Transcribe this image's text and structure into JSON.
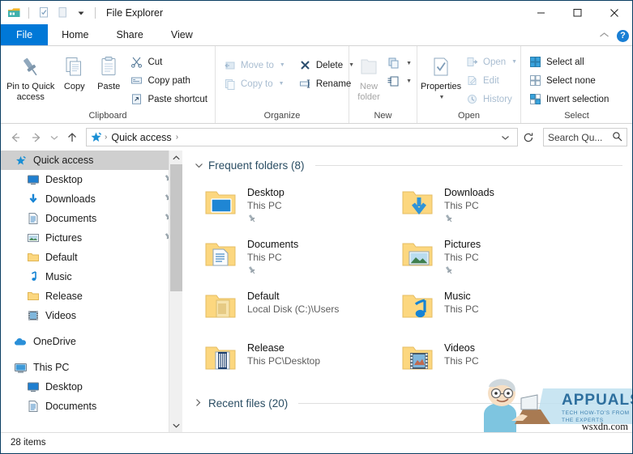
{
  "window": {
    "title": "File Explorer",
    "controls": {
      "minimize": "—",
      "maximize": "☐",
      "close": "✕"
    },
    "quick_access_toolbar": [
      "explorer-icon",
      "properties-checkbox-icon",
      "new-folder-icon",
      "customize-dropdown-icon"
    ]
  },
  "tabs": [
    {
      "label": "File",
      "kind": "file"
    },
    {
      "label": "Home",
      "kind": "active"
    },
    {
      "label": "Share",
      "kind": "normal"
    },
    {
      "label": "View",
      "kind": "normal"
    }
  ],
  "tabbar_right": {
    "collapse": "⌃",
    "help": "?"
  },
  "ribbon": {
    "groups": [
      {
        "label": "Clipboard",
        "big_buttons": [
          {
            "label": "Pin to Quick access",
            "icon": "pin-icon",
            "disabled": false
          },
          {
            "label": "Copy",
            "icon": "copy-icon",
            "disabled": false
          },
          {
            "label": "Paste",
            "icon": "paste-icon",
            "disabled": false
          }
        ],
        "small_buttons": [
          {
            "label": "Cut",
            "icon": "scissors-icon",
            "disabled": false,
            "caret": false
          },
          {
            "label": "Copy path",
            "icon": "copy-path-icon",
            "disabled": false,
            "caret": false
          },
          {
            "label": "Paste shortcut",
            "icon": "paste-shortcut-icon",
            "disabled": false,
            "caret": false
          }
        ]
      },
      {
        "label": "Organize",
        "small_buttons_a": [
          {
            "label": "Move to",
            "icon": "move-to-icon",
            "disabled": true,
            "caret": true
          },
          {
            "label": "Copy to",
            "icon": "copy-to-icon",
            "disabled": true,
            "caret": true
          }
        ],
        "small_buttons_b": [
          {
            "label": "Delete",
            "icon": "delete-x-icon",
            "disabled": false,
            "caret": true
          },
          {
            "label": "Rename",
            "icon": "rename-icon",
            "disabled": false,
            "caret": false
          }
        ]
      },
      {
        "label": "New",
        "big_buttons": [
          {
            "label": "New folder",
            "icon": "new-folder-icon",
            "disabled": true
          }
        ],
        "stacked_buttons": [
          {
            "label": "",
            "icon": "new-item-icon",
            "caret": true
          },
          {
            "label": "",
            "icon": "easy-access-icon",
            "caret": true
          }
        ]
      },
      {
        "label": "Open",
        "big_buttons": [
          {
            "label": "Properties",
            "icon": "properties-icon",
            "disabled": false,
            "caret": true
          }
        ],
        "small_buttons": [
          {
            "label": "Open",
            "icon": "open-icon",
            "disabled": true,
            "caret": true
          },
          {
            "label": "Edit",
            "icon": "edit-icon",
            "disabled": true,
            "caret": false
          },
          {
            "label": "History",
            "icon": "history-icon",
            "disabled": true,
            "caret": false
          }
        ]
      },
      {
        "label": "Select",
        "small_buttons": [
          {
            "label": "Select all",
            "icon": "select-all-icon",
            "disabled": false,
            "caret": false
          },
          {
            "label": "Select none",
            "icon": "select-none-icon",
            "disabled": false,
            "caret": false
          },
          {
            "label": "Invert selection",
            "icon": "invert-selection-icon",
            "disabled": false,
            "caret": false
          }
        ]
      }
    ]
  },
  "addressbar": {
    "back": "←",
    "forward": "→",
    "recent": "⌄",
    "up": "↑",
    "crumb_icon": "quick-access-star-icon",
    "crumbs": [
      "Quick access"
    ],
    "separator": "›",
    "history_dropdown": "⌄",
    "refresh": "↻",
    "search_placeholder": "Search Qu...",
    "search_value": "",
    "search_icon": "magnifier-icon"
  },
  "sidebar": {
    "items": [
      {
        "label": "Quick access",
        "icon": "quick-access-star-icon",
        "selected": true,
        "pinned": false,
        "indent": 0
      },
      {
        "label": "Desktop",
        "icon": "desktop-icon",
        "selected": false,
        "pinned": true,
        "indent": 1
      },
      {
        "label": "Downloads",
        "icon": "downloads-arrow-icon",
        "selected": false,
        "pinned": true,
        "indent": 1
      },
      {
        "label": "Documents",
        "icon": "documents-icon",
        "selected": false,
        "pinned": true,
        "indent": 1
      },
      {
        "label": "Pictures",
        "icon": "pictures-icon",
        "selected": false,
        "pinned": true,
        "indent": 1
      },
      {
        "label": "Default",
        "icon": "folder-icon",
        "selected": false,
        "pinned": false,
        "indent": 1
      },
      {
        "label": "Music",
        "icon": "music-note-icon",
        "selected": false,
        "pinned": false,
        "indent": 1
      },
      {
        "label": "Release",
        "icon": "folder-icon",
        "selected": false,
        "pinned": false,
        "indent": 1
      },
      {
        "label": "Videos",
        "icon": "videos-filmstrip-icon",
        "selected": false,
        "pinned": false,
        "indent": 1
      },
      {
        "label": "OneDrive",
        "icon": "onedrive-cloud-icon",
        "selected": false,
        "pinned": false,
        "indent": 0,
        "gap_before": true
      },
      {
        "label": "This PC",
        "icon": "this-pc-icon",
        "selected": false,
        "pinned": false,
        "indent": 0,
        "gap_before": true
      },
      {
        "label": "Desktop",
        "icon": "desktop-icon",
        "selected": false,
        "pinned": false,
        "indent": 1
      },
      {
        "label": "Documents",
        "icon": "documents-icon",
        "selected": false,
        "pinned": false,
        "indent": 1
      }
    ],
    "scrollbar": {
      "up": "⌃",
      "down": "⌄"
    }
  },
  "content": {
    "sections": [
      {
        "title": "Frequent folders (8)",
        "expanded": true,
        "chevron": "⌄"
      },
      {
        "title": "Recent files (20)",
        "expanded": false,
        "chevron": "›"
      }
    ],
    "frequent_folders": [
      {
        "name": "Desktop",
        "path": "This PC",
        "icon": "folder-desktop-icon",
        "pinned": true
      },
      {
        "name": "Downloads",
        "path": "This PC",
        "icon": "folder-downloads-icon",
        "pinned": true
      },
      {
        "name": "Documents",
        "path": "This PC",
        "icon": "folder-documents-icon",
        "pinned": true
      },
      {
        "name": "Pictures",
        "path": "This PC",
        "icon": "folder-pictures-icon",
        "pinned": true
      },
      {
        "name": "Default",
        "path": "Local Disk (C:)\\Users",
        "icon": "folder-default-icon",
        "pinned": false
      },
      {
        "name": "Music",
        "path": "This PC",
        "icon": "folder-music-icon",
        "pinned": false
      },
      {
        "name": "Release",
        "path": "This PC\\Desktop",
        "icon": "folder-release-icon",
        "pinned": false
      },
      {
        "name": "Videos",
        "path": "This PC",
        "icon": "folder-videos-icon",
        "pinned": false
      }
    ]
  },
  "statusbar": {
    "item_count": "28 items"
  },
  "watermark": {
    "brand": "APPUALS",
    "tagline": "TECH HOW-TO'S FROM THE EXPERTS",
    "source": "wsxdn.com"
  },
  "colors": {
    "accent": "#0078d7",
    "title_border": "#0a3d62",
    "selection": "#cfcfcf",
    "section_title": "#2a4d63",
    "folder_yellow": "#fcd77f",
    "disabled_text": "#a9bdd1"
  }
}
